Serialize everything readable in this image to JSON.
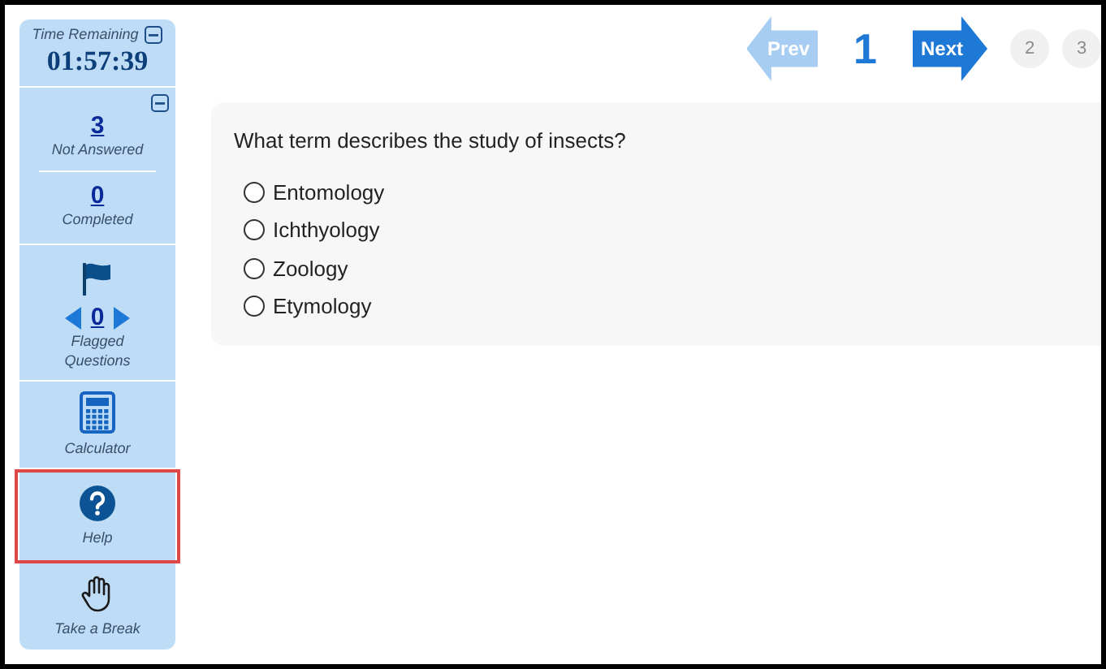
{
  "timer": {
    "label": "Time Remaining",
    "value": "01:57:39"
  },
  "status": {
    "not_answered": {
      "count": "3",
      "label": "Not Answered"
    },
    "completed": {
      "count": "0",
      "label": "Completed"
    }
  },
  "flagged": {
    "count": "0",
    "label": "Flagged Questions"
  },
  "tools": [
    {
      "kind": "calculator",
      "label": "Calculator",
      "highlighted": false
    },
    {
      "kind": "help",
      "label": "Help",
      "highlighted": true
    },
    {
      "kind": "break",
      "label": "Take a Break",
      "highlighted": false
    }
  ],
  "nav": {
    "prev": {
      "label": "Prev",
      "disabled": true
    },
    "current": "1",
    "next": {
      "label": "Next",
      "disabled": false
    },
    "pages": [
      "2",
      "3"
    ]
  },
  "question": {
    "text": "What term describes the study of insects?",
    "options": [
      {
        "label": "Entomology",
        "selected": false
      },
      {
        "label": "Ichthyology",
        "selected": false
      },
      {
        "label": "Zoology",
        "selected": false
      },
      {
        "label": "Etymology",
        "selected": false
      }
    ]
  }
}
